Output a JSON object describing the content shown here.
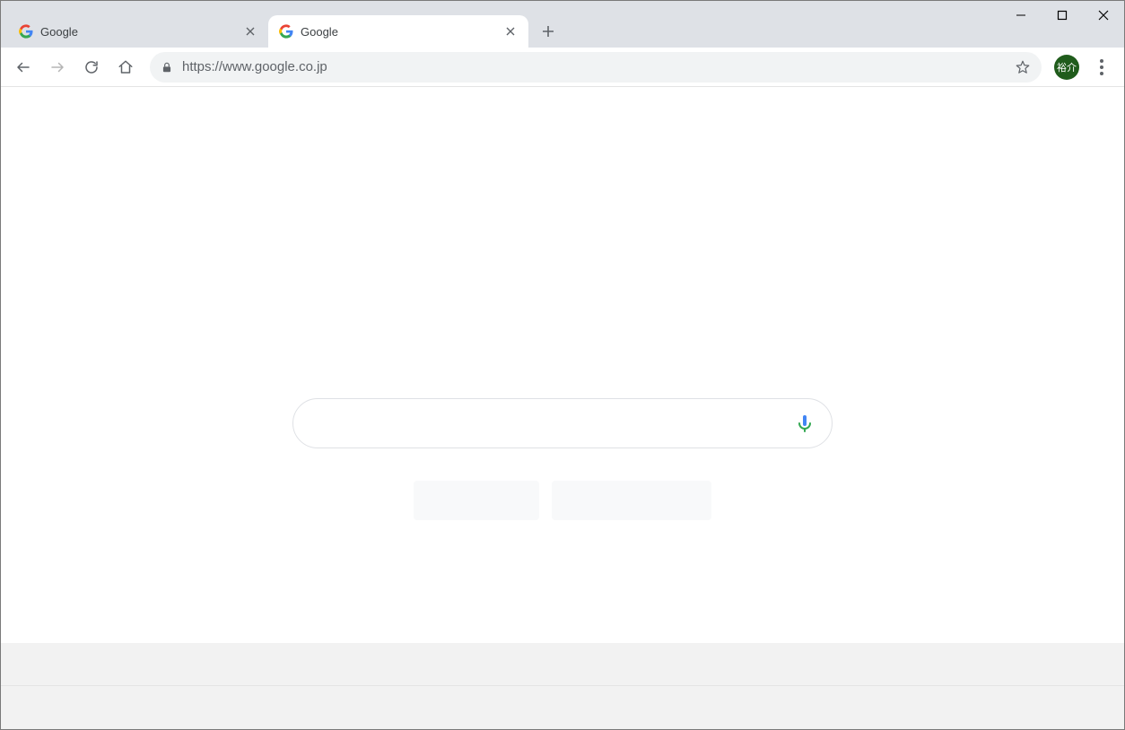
{
  "window": {
    "tabs": [
      {
        "title": "Google",
        "active": false
      },
      {
        "title": "Google",
        "active": true
      }
    ],
    "avatar_label": "裕介"
  },
  "toolbar": {
    "url": "https://www.google.co.jp"
  },
  "page": {
    "search_value": "",
    "buttons": {
      "search": "",
      "lucky": ""
    }
  }
}
